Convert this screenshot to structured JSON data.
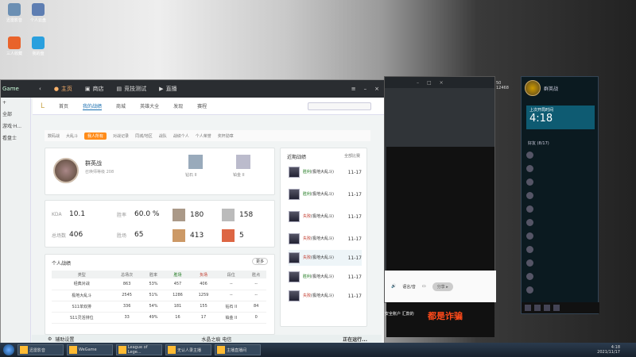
{
  "desktop": {
    "icons": [
      {
        "label": "迅雷影音"
      },
      {
        "label": "个人云盘"
      },
      {
        "label": "三人收藏"
      },
      {
        "label": "我的盘"
      }
    ]
  },
  "lol": {
    "window_title": "Game",
    "tabs": [
      {
        "label": "主页"
      },
      {
        "label": "商店"
      },
      {
        "label": "竞技测试"
      },
      {
        "label": "直播"
      }
    ],
    "nav": [
      "首页",
      "我的战绩",
      "商城",
      "英雄大全",
      "发现",
      "赛程"
    ],
    "sidebar": [
      "+",
      "全部",
      "游戏·H...",
      "看盘士"
    ],
    "subnav": [
      "数码战",
      "大乱斗",
      "我人所有",
      "对战记录",
      "同城/地区",
      "战队",
      "战绩个人",
      "个人荣誉",
      "奖杯勋章"
    ],
    "profile": {
      "name": "群英战",
      "level": "召唤师等级 208",
      "rank1": "钻石 II",
      "rank2": "铂金 II"
    },
    "stats": {
      "kda_label": "KDA",
      "kda": "10.1",
      "winrate_label": "胜率",
      "winrate": "60.0 %",
      "games_label": "总场数",
      "games": "406",
      "wins_label": "胜场",
      "wins": "65",
      "v1": "180",
      "v2": "158",
      "v3": "413",
      "v4": "5"
    },
    "personal": {
      "title": "个人战绩",
      "more": "更多",
      "headers": [
        "类型",
        "总场次",
        "胜率",
        "胜场",
        "负场",
        "段位",
        "胜点"
      ],
      "rows": [
        [
          "经典对战",
          "863",
          "53%",
          "457",
          "406",
          "--",
          "--"
        ],
        [
          "极地大乱斗",
          "2545",
          "51%",
          "1286",
          "1259",
          "--",
          "--"
        ],
        [
          "S11单双排",
          "336",
          "54%",
          "181",
          "155",
          "钻石 II",
          "84"
        ],
        [
          "S11灵活排位",
          "33",
          "49%",
          "16",
          "17",
          "铂金 II",
          "0"
        ]
      ]
    },
    "recent": {
      "title": "近期战绩",
      "filter": "全部比赛",
      "items": [
        {
          "result": "胜利",
          "mode": "(极地大乱斗)",
          "date": "11-17"
        },
        {
          "result": "胜利",
          "mode": "(极地大乱斗)",
          "date": "11-17"
        },
        {
          "result": "失败",
          "mode": "(极地大乱斗)",
          "date": "11-17"
        },
        {
          "result": "失败",
          "mode": "(极地大乱斗)",
          "date": "11-17"
        },
        {
          "result": "失败",
          "mode": "(极地大乱斗)",
          "date": "11-17"
        },
        {
          "result": "胜利",
          "mode": "(极地大乱斗)",
          "date": "11-17"
        },
        {
          "result": "失败",
          "mode": "(极地大乱斗)",
          "date": "11-17"
        }
      ]
    },
    "bottom": {
      "label": "辅助设置",
      "game": "水晶之痕 电信",
      "status": "正在运行..."
    }
  },
  "win2": {
    "pill": "分享 ▸",
    "warning": "安全账户 汇款的",
    "scam": "都是诈骗",
    "sound_label": "语言/音"
  },
  "chat": {
    "name": "群英战",
    "timer_label": "上次开局时间",
    "timer": "4:18",
    "num1": "50",
    "num2": "12468",
    "group": "好友 (8/17)"
  },
  "taskbar": {
    "items": [
      "迅雷影音",
      "WeGame",
      "League of Lege...",
      "无认人录主播",
      "主播直播间"
    ],
    "time": "4:18",
    "date": "2021/11/17"
  }
}
